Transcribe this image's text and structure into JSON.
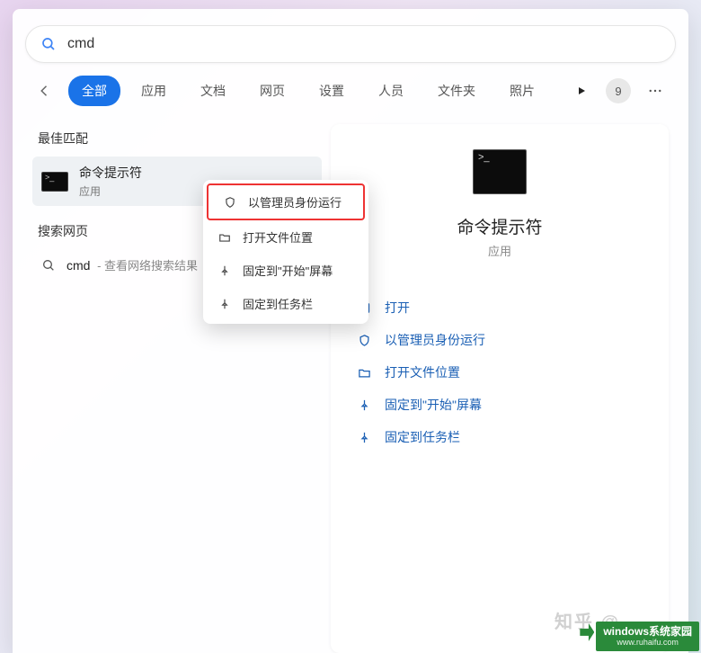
{
  "search": {
    "value": "cmd"
  },
  "tabs": {
    "items": [
      "全部",
      "应用",
      "文档",
      "网页",
      "设置",
      "人员",
      "文件夹",
      "照片"
    ],
    "active_index": 0,
    "count_badge": "9"
  },
  "left": {
    "best_match_label": "最佳匹配",
    "result": {
      "title": "命令提示符",
      "subtitle": "应用"
    },
    "web_label": "搜索网页",
    "web_item": {
      "title": "cmd",
      "suffix": " - 查看网络搜索结果"
    }
  },
  "context_menu": {
    "items": [
      {
        "icon": "shield",
        "label": "以管理员身份运行",
        "highlight": true
      },
      {
        "icon": "folder",
        "label": "打开文件位置"
      },
      {
        "icon": "pin",
        "label": "固定到\"开始\"屏幕"
      },
      {
        "icon": "pin",
        "label": "固定到任务栏"
      }
    ]
  },
  "right": {
    "app_name": "命令提示符",
    "app_type": "应用",
    "actions": [
      {
        "icon": "open",
        "label": "打开"
      },
      {
        "icon": "shield",
        "label": "以管理员身份运行"
      },
      {
        "icon": "folder",
        "label": "打开文件位置"
      },
      {
        "icon": "pin",
        "label": "固定到\"开始\"屏幕"
      },
      {
        "icon": "pin",
        "label": "固定到任务栏"
      }
    ]
  },
  "watermark": {
    "zhihu_prefix": "知乎 @",
    "badge_line1": "windows系统家园",
    "badge_line2": "www.ruhaifu.com"
  }
}
